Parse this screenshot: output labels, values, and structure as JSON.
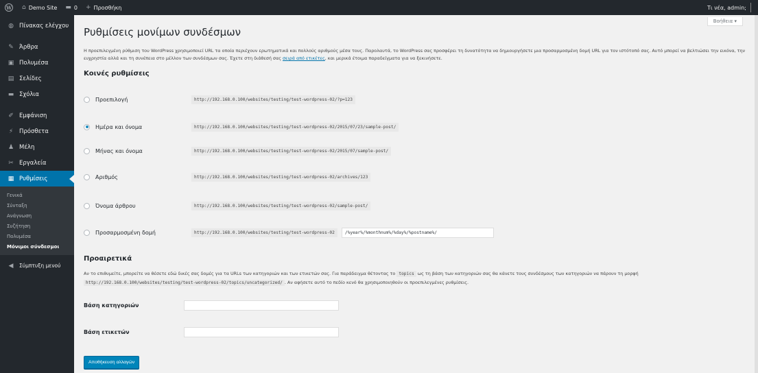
{
  "adminbar": {
    "site_name": "Demo Site",
    "comments_count": "0",
    "new_label": "Προσθήκη",
    "greeting": "Τι νέα, admin;"
  },
  "sidebar": {
    "items": [
      {
        "label": "Πίνακας ελέγχου",
        "icon": "dashboard-icon",
        "glyph": "◍"
      },
      {
        "label": "Άρθρα",
        "icon": "pin-icon",
        "glyph": "✎"
      },
      {
        "label": "Πολυμέσα",
        "icon": "media-icon",
        "glyph": "▣"
      },
      {
        "label": "Σελίδες",
        "icon": "pages-icon",
        "glyph": "▤"
      },
      {
        "label": "Σχόλια",
        "icon": "comments-icon",
        "glyph": "▬"
      },
      {
        "label": "Εμφάνιση",
        "icon": "appearance-icon",
        "glyph": "✐"
      },
      {
        "label": "Πρόσθετα",
        "icon": "plugins-icon",
        "glyph": "⚡"
      },
      {
        "label": "Μέλη",
        "icon": "users-icon",
        "glyph": "♟"
      },
      {
        "label": "Εργαλεία",
        "icon": "tools-icon",
        "glyph": "✂"
      },
      {
        "label": "Ρυθμίσεις",
        "icon": "settings-icon",
        "glyph": "▦"
      }
    ],
    "submenu": [
      "Γενικά",
      "Σύνταξη",
      "Ανάγνωση",
      "Συζήτηση",
      "Πολυμέσα",
      "Μόνιμοι σύνδεσμοι"
    ],
    "collapse_label": "Σύμπτυξη μενού"
  },
  "help_tab": "Βοήθεια ▾",
  "page_title": "Ρυθμίσεις μονίμων συνδέσμων",
  "intro": {
    "text1": "Η προεπιλεγμένη ρύθμιση του WordPress χρησιμοποιεί URL τα οποία περιέχουν ερωτηματικά και πολλούς αριθμούς μέσα τους. Παρολαυτά, το WordPress σας προσφέρει τη δυνατότητα να δημιουργήσετε μια προσαρμοσμένη δομή URL για τον ιστότοπό σας. Αυτό μπορεί να βελτιώσει την εικόνα, την ευχρηστία αλλά και τη συνέπεια στο μέλλον των συνδέσμων σας. Έχετε στη διάθεσή σας ",
    "link": "σειρά από ετικέτες",
    "text2": ", και μερικά έτοιμα παραδείγματα για να ξεκινήσετε."
  },
  "common_heading": "Κοινές ρυθμίσεις",
  "options": [
    {
      "label": "Προεπιλογή",
      "example": "http://192.168.0.100/websites/testing/test-wordpress-02/?p=123",
      "checked": false
    },
    {
      "label": "Ημέρα και όνομα",
      "example": "http://192.168.0.100/websites/testing/test-wordpress-02/2015/07/23/sample-post/",
      "checked": true
    },
    {
      "label": "Μήνας και όνομα",
      "example": "http://192.168.0.100/websites/testing/test-wordpress-02/2015/07/sample-post/",
      "checked": false
    },
    {
      "label": "Αριθμός",
      "example": "http://192.168.0.100/websites/testing/test-wordpress-02/archives/123",
      "checked": false
    },
    {
      "label": "Όνομα άρθρου",
      "example": "http://192.168.0.100/websites/testing/test-wordpress-02/sample-post/",
      "checked": false
    },
    {
      "label": "Προσαρμοσμένη δομή",
      "example": "http://192.168.0.100/websites/testing/test-wordpress-02",
      "checked": false
    }
  ],
  "custom_structure_value": "/%year%/%monthnum%/%day%/%postname%/",
  "optional_heading": "Προαιρετικά",
  "optional": {
    "text1": "Αν το επιθυμείτε, μπορείτε να θέσετε εδώ δικές σας δομές για τα URLs των κατηγοριών και των ετικετών σας. Για παράδειγμα θέτοντας το ",
    "code1": "topics",
    "text2": " ως τη βάση των κατηγοριών σας θα κάνετε τους συνδέσμους των κατηγοριών να πάρουν τη μορφή ",
    "code2": "http://192.168.0.100/websites/testing/test-wordpress-02/topics/uncategorized/",
    "text3": ". Αν αφήσετε αυτό το πεδίο κενό θα χρησιμοποιηθούν οι προεπιλεγμένες ρυθμίσεις."
  },
  "category_base_label": "Βάση κατηγοριών",
  "category_base_value": "",
  "tag_base_label": "Βάση ετικετών",
  "tag_base_value": "",
  "save_label": "Αποθήκευση αλλαγών"
}
